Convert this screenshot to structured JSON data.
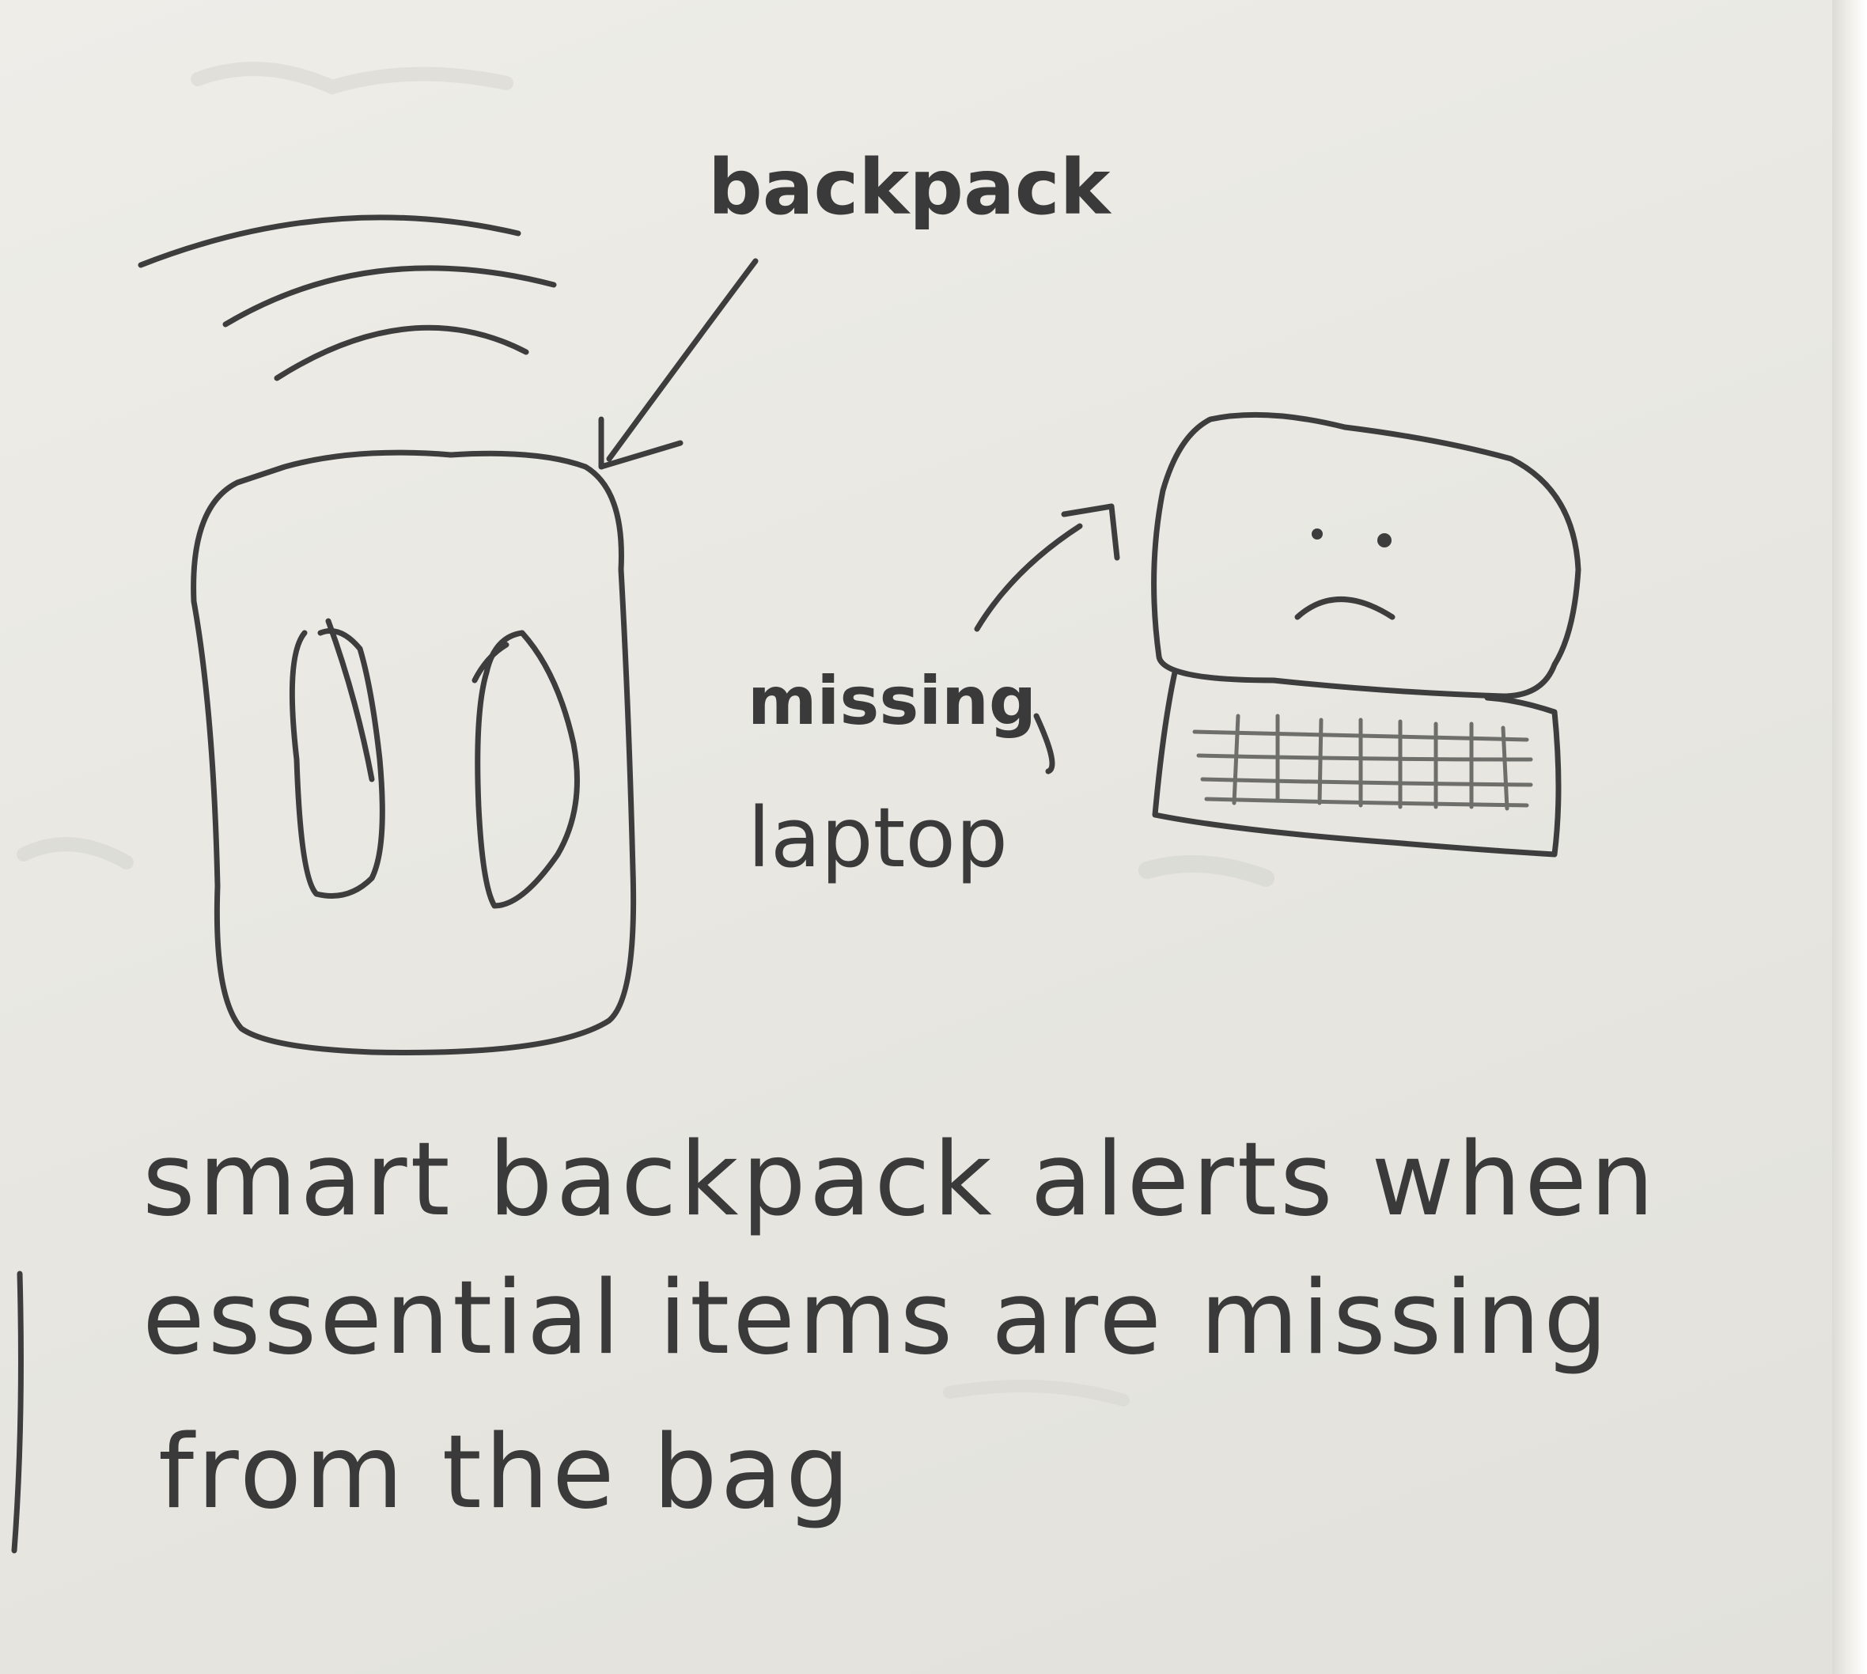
{
  "labels": {
    "backpack": "backpack",
    "missing": "missing",
    "laptop": "laptop"
  },
  "caption": {
    "line1": "smart backpack alerts when",
    "line2": "essential items are missing",
    "line3": "from the bag"
  },
  "colors": {
    "paper": "#e9e8e3",
    "ink": "#3d3d3d"
  }
}
